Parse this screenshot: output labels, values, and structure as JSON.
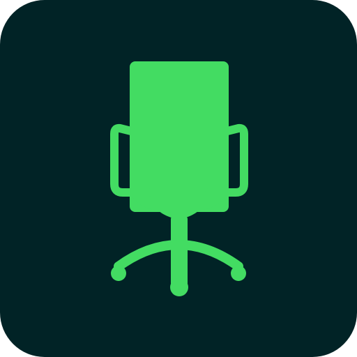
{
  "icon": {
    "name": "office-chair-icon",
    "background_color": "#012326",
    "foreground_color": "#43DC62"
  }
}
